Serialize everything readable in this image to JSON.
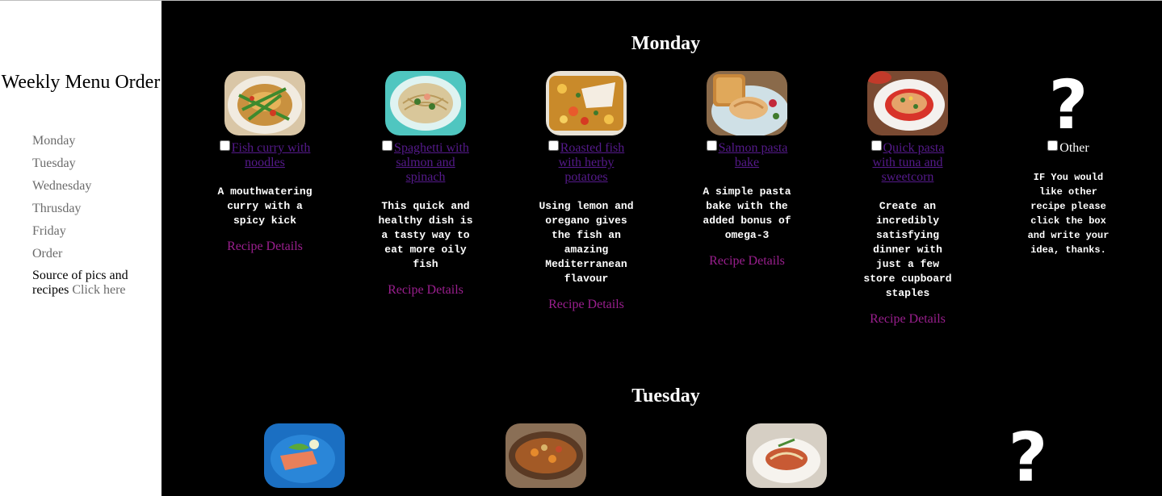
{
  "sidebar": {
    "title": "Weekly Menu Order",
    "nav": [
      "Monday",
      "Tuesday",
      "Wednesday",
      "Thrusday",
      "Friday",
      "Order"
    ],
    "source_text": "Source of pics and recipes",
    "source_link": "Click here"
  },
  "monday": {
    "heading": "Monday",
    "dishes": [
      {
        "title": "Fish curry with noodles",
        "description": "A mouthwatering curry with a spicy kick",
        "details": "Recipe Details",
        "image": "fish-curry-image"
      },
      {
        "title": "Spaghetti with salmon and spinach",
        "description": "This quick and healthy dish is a tasty way to eat more oily fish",
        "details": "Recipe Details",
        "image": "spaghetti-salmon-image"
      },
      {
        "title": "Roasted fish with herby potatoes",
        "description": "Using lemon and oregano gives the fish an amazing Mediterranean flavour",
        "details": "Recipe Details",
        "image": "roasted-fish-image"
      },
      {
        "title": "Salmon pasta bake",
        "description": "A simple pasta bake with the added bonus of omega-3",
        "details": "Recipe Details",
        "image": "salmon-pasta-bake-image"
      },
      {
        "title": "Quick pasta with tuna and sweetcorn",
        "description": "Create an incredibly satisfying dinner with just a few store cupboard staples",
        "details": "Recipe Details",
        "image": "tuna-pasta-image"
      }
    ],
    "other": {
      "symbol": "?",
      "label": "Other",
      "description": "IF You would like other recipe please click the box and write your idea, thanks."
    }
  },
  "tuesday": {
    "heading": "Tuesday",
    "images": [
      "salmon-plate-image",
      "stew-image",
      "noodle-bowl-image"
    ],
    "other_symbol": "?"
  },
  "colors": {
    "background": "#000000",
    "sidebar": "#ffffff",
    "link": "#551a8b",
    "details": "#9a1f8e",
    "nav_text": "#6b6b6b"
  }
}
